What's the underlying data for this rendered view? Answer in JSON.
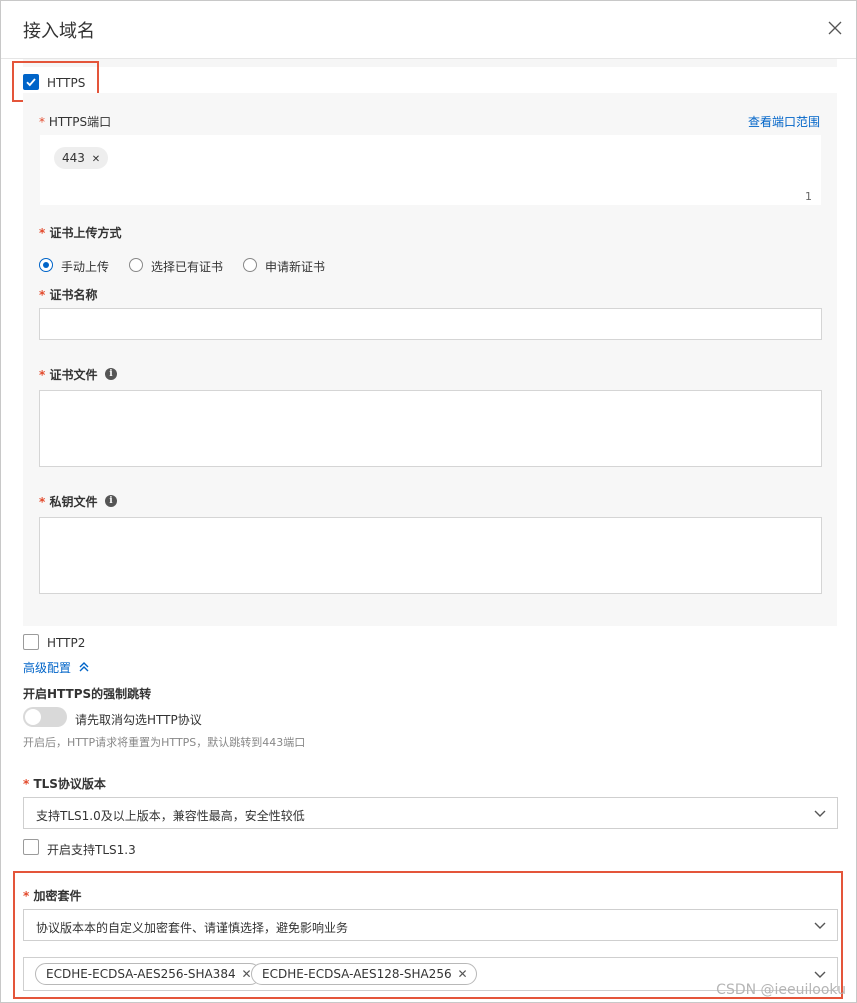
{
  "dialog": {
    "title": "接入域名",
    "close_icon": "close-icon"
  },
  "https": {
    "label": "HTTPS",
    "checked": true,
    "port": {
      "label": "HTTPS端口",
      "view_range_link": "查看端口范围",
      "tags": [
        "443"
      ],
      "count": "1"
    },
    "cert_upload": {
      "label": "证书上传方式",
      "options": [
        "手动上传",
        "选择已有证书",
        "申请新证书"
      ],
      "selected": "手动上传"
    },
    "cert_name": {
      "label": "证书名称",
      "value": ""
    },
    "cert_file": {
      "label": "证书文件",
      "value": ""
    },
    "private_key": {
      "label": "私钥文件",
      "value": ""
    }
  },
  "http2": {
    "label": "HTTP2",
    "checked": false
  },
  "advanced": {
    "label": "高级配置"
  },
  "force_redirect": {
    "heading": "开启HTTPS的强制跳转",
    "toggle_label": "请先取消勾选HTTP协议",
    "enabled": false,
    "help": "开启后，HTTP请求将重置为HTTPS，默认跳转到443端口"
  },
  "tls": {
    "label": "TLS协议版本",
    "selected": "支持TLS1.0及以上版本，兼容性最高，安全性较低",
    "tls13_label": "开启支持TLS1.3",
    "tls13_checked": false
  },
  "cipher": {
    "label": "加密套件",
    "selected": "协议版本本的自定义加密套件、请谨慎选择，避免影响业务",
    "suites": [
      "ECDHE-ECDSA-AES256-SHA384",
      "ECDHE-ECDSA-AES128-SHA256"
    ]
  },
  "watermark": "CSDN @ieeuilooku",
  "colors": {
    "accent": "#0064c8",
    "required": "#e34a2c",
    "highlight_box": "#e4553a"
  }
}
